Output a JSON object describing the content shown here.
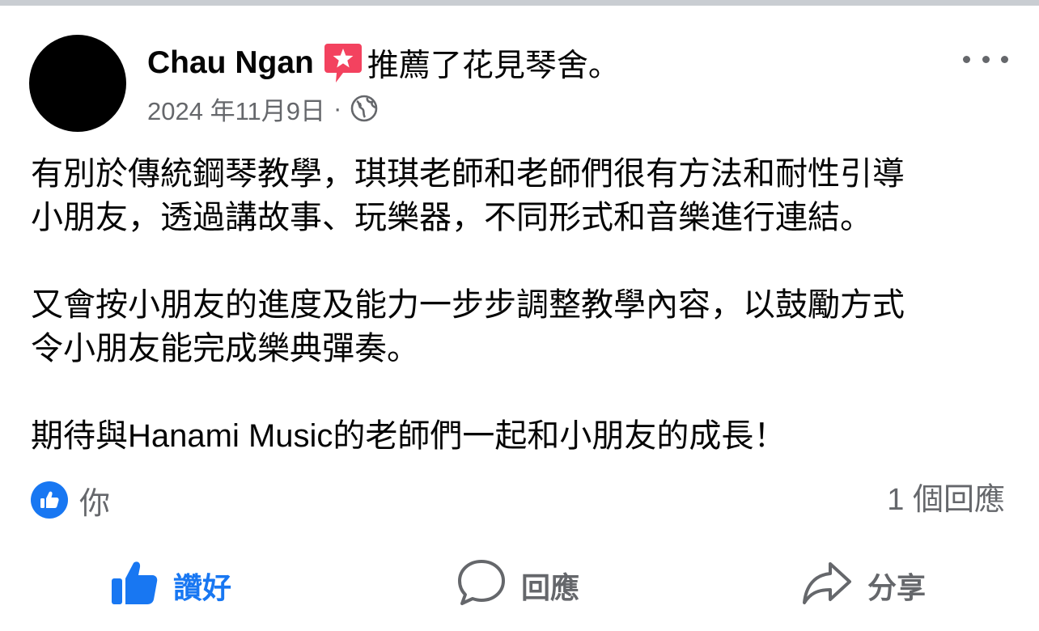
{
  "post": {
    "author": "Chau Ngan",
    "recommend_text": "推薦了花見琴舍。",
    "date": "2024 年11月9日",
    "separator": "·",
    "audience_icon": "globe-icon",
    "recommend_icon": "recommendation-star-icon",
    "more_icon": "more-options-icon",
    "body": [
      "有別於傳統鋼琴教學，琪琪老師和老師們很有方法和耐性引導",
      "小朋友，透過講故事、玩樂器，不同形式和音樂進行連結。",
      "又會按小朋友的進度及能力一步步調整教學內容，以鼓勵方式",
      "令小朋友能完成樂典彈奏。",
      "期待與Hanami Music的老師們一起和小朋友的成長！"
    ]
  },
  "reactions": {
    "icon": "like-reaction-icon",
    "names": "你",
    "comment_count": "1 個回應"
  },
  "actions": {
    "like": "讚好",
    "comment": "回應",
    "share": "分享"
  },
  "colors": {
    "brand_blue": "#1877f2",
    "secondary_text": "#65676b",
    "recommend_red": "#f3425f",
    "avatar": "#000000"
  }
}
